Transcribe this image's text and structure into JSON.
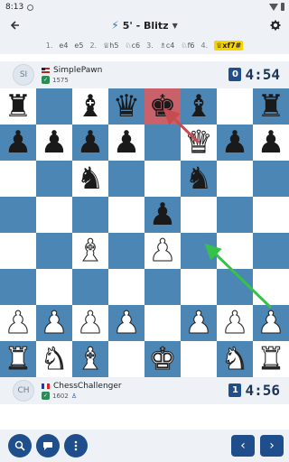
{
  "statusbar": {
    "time": "8:13"
  },
  "header": {
    "title": "5' - Blitz",
    "back_icon": "arrow-left-icon",
    "settings_icon": "gear-icon"
  },
  "moves": [
    {
      "num": "1.",
      "white": "e4",
      "black": "e5"
    },
    {
      "num": "2.",
      "white": "♕h5",
      "black": "♘c6"
    },
    {
      "num": "3.",
      "white": "♗c4",
      "black": "♘f6"
    },
    {
      "num": "4.",
      "white": "♕xf7#",
      "black": ""
    }
  ],
  "top_player": {
    "avatar": "SI",
    "name": "SimplePawn",
    "rating": "1575",
    "country": "US",
    "clock_count": "0",
    "clock": "4:54"
  },
  "bottom_player": {
    "avatar": "CH",
    "name": "ChessChallenger",
    "rating": "1602",
    "country": "FR",
    "clock_count": "1",
    "clock": "4:56"
  },
  "board": [
    [
      "bR",
      "",
      "bB",
      "bQ",
      "bK",
      "bB",
      "",
      "bR"
    ],
    [
      "bP",
      "bP",
      "bP",
      "bP",
      "",
      "wQ",
      "bP",
      "bP"
    ],
    [
      "",
      "",
      "bN",
      "",
      "",
      "bN",
      "",
      ""
    ],
    [
      "",
      "",
      "",
      "",
      "bP",
      "",
      "",
      ""
    ],
    [
      "",
      "",
      "wB",
      "",
      "wP",
      "",
      "",
      ""
    ],
    [
      "",
      "",
      "",
      "",
      "",
      "",
      "",
      ""
    ],
    [
      "wP",
      "wP",
      "wP",
      "wP",
      "",
      "wP",
      "wP",
      "wP"
    ],
    [
      "wR",
      "wN",
      "wB",
      "",
      "wK",
      "",
      "wN",
      "wR"
    ]
  ],
  "highlight_squares": [
    "e8"
  ],
  "colors": {
    "dark_square": "#4b86b4",
    "light_square": "#ffffff",
    "highlight": "#c9616b",
    "accent": "#1f4e8c",
    "current_move": "#f7d300"
  },
  "bottom_bar": {
    "buttons": [
      "analysis-icon",
      "chat-icon",
      "more-icon"
    ],
    "prev_icon": "chevron-left-icon",
    "next_icon": "chevron-right-icon"
  }
}
